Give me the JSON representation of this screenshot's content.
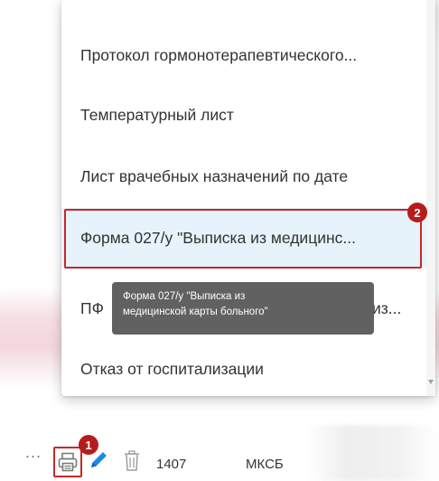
{
  "menu": {
    "items": [
      {
        "label": "Протокол гормонотерапевтического..."
      },
      {
        "label": "Температурный лист"
      },
      {
        "label": "Лист врачебных назначений по дате"
      },
      {
        "label": "Форма 027/у \"Выписка из медицинс..."
      },
      {
        "label": "ПФ",
        "label_end": "из..."
      },
      {
        "label": "Отказ от госпитализации"
      }
    ],
    "highlighted_index": 3
  },
  "tooltip": {
    "line1": "Форма 027/у \"Выписка из",
    "line2": "медицинской карты больного\""
  },
  "badges": {
    "first": "1",
    "second": "2"
  },
  "table_row": {
    "more": "...",
    "number": "1407",
    "type": "МКСБ"
  },
  "icons": [
    "more-icon",
    "printer-icon",
    "pencil-icon",
    "trash-icon"
  ],
  "colors": {
    "highlight_border": "#c62828",
    "badge": "#b71c1c",
    "selected_item_bg": "#e6f3fa",
    "tooltip_bg": "#616161",
    "accent_blue": "#1e88e5"
  }
}
